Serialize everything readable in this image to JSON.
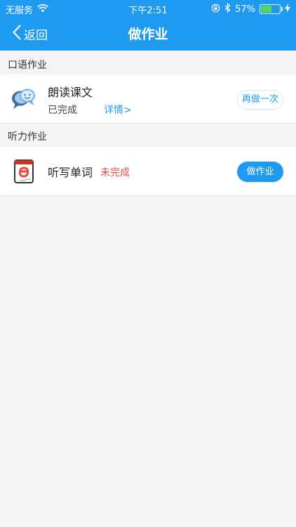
{
  "status_bar": {
    "carrier": "无服务",
    "time": "下午2:51",
    "battery_percent": "57%",
    "battery_level": 0.57
  },
  "nav": {
    "back_label": "返回",
    "title": "做作业"
  },
  "sections": [
    {
      "header": "口语作业",
      "item": {
        "title": "朗读课文",
        "status": "已完成",
        "detail_link": "详情>",
        "action": "再做一次"
      }
    },
    {
      "header": "听力作业",
      "item": {
        "title": "听写单词",
        "status": "未完成",
        "action": "做作业"
      }
    }
  ],
  "colors": {
    "brand_blue": "#1e9af0",
    "incomplete_red": "#e74c3c"
  }
}
